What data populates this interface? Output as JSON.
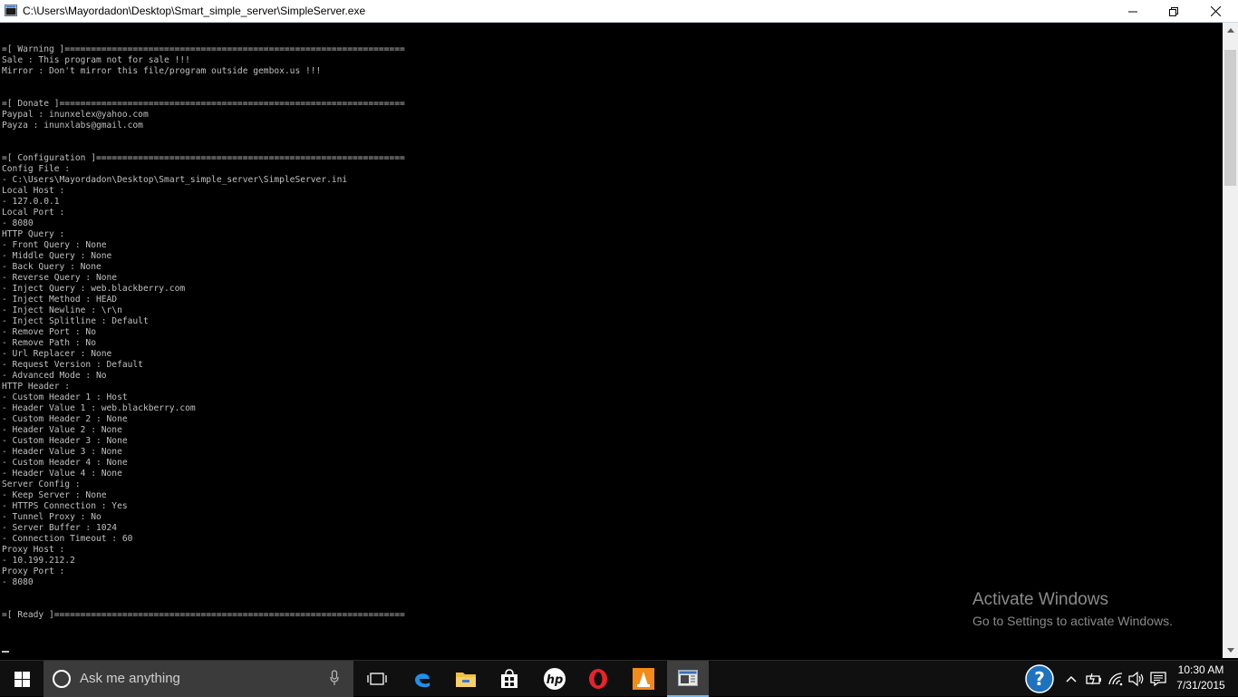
{
  "window": {
    "title": "C:\\Users\\Mayordadon\\Desktop\\Smart_simple_server\\SimpleServer.exe",
    "controls": [
      "minimize-button",
      "maximize-button",
      "close-button"
    ]
  },
  "console": {
    "lines": [
      "=[ Warning ]=================================================================",
      "Sale : This program not for sale !!!",
      "Mirror : Don't mirror this file/program outside gembox.us !!!",
      "",
      "",
      "=[ Donate ]==================================================================",
      "Paypal : inunxelex@yahoo.com",
      "Payza : inunxlabs@gmail.com",
      "",
      "",
      "=[ Configuration ]===========================================================",
      "Config File :",
      "- C:\\Users\\Mayordadon\\Desktop\\Smart_simple_server\\SimpleServer.ini",
      "Local Host :",
      "- 127.0.0.1",
      "Local Port :",
      "- 8080",
      "HTTP Query :",
      "- Front Query : None",
      "- Middle Query : None",
      "- Back Query : None",
      "- Reverse Query : None",
      "- Inject Query : web.blackberry.com",
      "- Inject Method : HEAD",
      "- Inject Newline : \\r\\n",
      "- Inject Splitline : Default",
      "- Remove Port : No",
      "- Remove Path : No",
      "- Url Replacer : None",
      "- Request Version : Default",
      "- Advanced Mode : No",
      "HTTP Header :",
      "- Custom Header 1 : Host",
      "- Header Value 1 : web.blackberry.com",
      "- Custom Header 2 : None",
      "- Header Value 2 : None",
      "- Custom Header 3 : None",
      "- Header Value 3 : None",
      "- Custom Header 4 : None",
      "- Header Value 4 : None",
      "Server Config :",
      "- Keep Server : None",
      "- HTTPS Connection : Yes",
      "- Tunnel Proxy : No",
      "- Server Buffer : 1024",
      "- Connection Timeout : 60",
      "Proxy Host :",
      "- 10.199.212.2",
      "Proxy Port :",
      "- 8080",
      "",
      "",
      "=[ Ready ]==================================================================="
    ],
    "text_color": "#c0c0c0",
    "background": "#000000"
  },
  "watermark": {
    "title": "Activate Windows",
    "subtitle": "Go to Settings to activate Windows."
  },
  "taskbar": {
    "search_placeholder": "Ask me anything",
    "pinned_icons": [
      "task-view-icon",
      "edge-icon",
      "file-explorer-icon",
      "store-icon",
      "hp-icon",
      "opera-icon",
      "vlc-icon",
      "console-app-icon"
    ],
    "tray_icons": [
      "help-icon",
      "chevron-up-icon",
      "battery-icon",
      "wifi-icon",
      "volume-icon",
      "notification-icon"
    ],
    "time": "10:30 AM",
    "date": "7/31/2015",
    "accent": "#76b9ed"
  }
}
